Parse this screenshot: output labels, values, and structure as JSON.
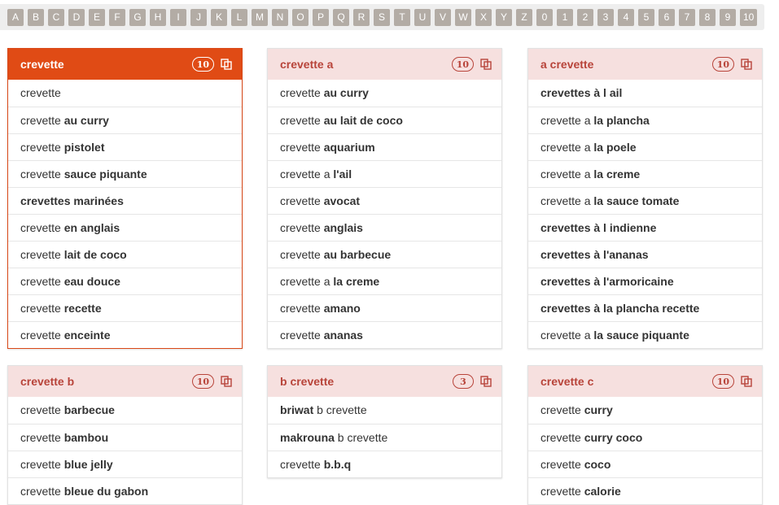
{
  "alphabet": [
    "A",
    "B",
    "C",
    "D",
    "E",
    "F",
    "G",
    "H",
    "I",
    "J",
    "K",
    "L",
    "M",
    "N",
    "O",
    "P",
    "Q",
    "R",
    "S",
    "T",
    "U",
    "V",
    "W",
    "X",
    "Y",
    "Z",
    "0",
    "1",
    "2",
    "3",
    "4",
    "5",
    "6",
    "7",
    "8",
    "9",
    "10"
  ],
  "colors": {
    "accent": "#e04b15",
    "header_pink": "#f6e0df",
    "title_red": "#b8443a",
    "letter_button": "#b3aca5",
    "bar_bg": "#eeeeee"
  },
  "icons": {
    "copy": "copy-icon"
  },
  "cards": [
    {
      "title": "crevette",
      "count": "10",
      "active": true,
      "rows": [
        {
          "pre": "crevette",
          "bold": "",
          "post": ""
        },
        {
          "pre": "crevette ",
          "bold": "au curry",
          "post": ""
        },
        {
          "pre": "crevette ",
          "bold": "pistolet",
          "post": ""
        },
        {
          "pre": "crevette ",
          "bold": "sauce piquante",
          "post": ""
        },
        {
          "pre": "",
          "bold": "crevettes marinées",
          "post": ""
        },
        {
          "pre": "crevette ",
          "bold": "en anglais",
          "post": ""
        },
        {
          "pre": "crevette ",
          "bold": "lait de coco",
          "post": ""
        },
        {
          "pre": "crevette ",
          "bold": "eau douce",
          "post": ""
        },
        {
          "pre": "crevette ",
          "bold": "recette",
          "post": ""
        },
        {
          "pre": "crevette ",
          "bold": "enceinte",
          "post": ""
        }
      ]
    },
    {
      "title": "crevette a",
      "count": "10",
      "active": false,
      "rows": [
        {
          "pre": "crevette ",
          "bold": "au curry",
          "post": ""
        },
        {
          "pre": "crevette ",
          "bold": "au lait de coco",
          "post": ""
        },
        {
          "pre": "crevette ",
          "bold": "aquarium",
          "post": ""
        },
        {
          "pre": "crevette a ",
          "bold": "l'ail",
          "post": ""
        },
        {
          "pre": "crevette ",
          "bold": "avocat",
          "post": ""
        },
        {
          "pre": "crevette ",
          "bold": "anglais",
          "post": ""
        },
        {
          "pre": "crevette ",
          "bold": "au barbecue",
          "post": ""
        },
        {
          "pre": "crevette a ",
          "bold": "la creme",
          "post": ""
        },
        {
          "pre": "crevette ",
          "bold": "amano",
          "post": ""
        },
        {
          "pre": "crevette ",
          "bold": "ananas",
          "post": ""
        }
      ]
    },
    {
      "title": "a crevette",
      "count": "10",
      "active": false,
      "rows": [
        {
          "pre": "",
          "bold": "crevettes à l ail",
          "post": ""
        },
        {
          "pre": "crevette a ",
          "bold": "la plancha",
          "post": ""
        },
        {
          "pre": "crevette a ",
          "bold": "la poele",
          "post": ""
        },
        {
          "pre": "crevette a ",
          "bold": "la creme",
          "post": ""
        },
        {
          "pre": "crevette a ",
          "bold": "la sauce tomate",
          "post": ""
        },
        {
          "pre": "",
          "bold": "crevettes à l indienne",
          "post": ""
        },
        {
          "pre": "",
          "bold": "crevettes à l'ananas",
          "post": ""
        },
        {
          "pre": "",
          "bold": "crevettes à l'armoricaine",
          "post": ""
        },
        {
          "pre": "",
          "bold": "crevettes à la plancha recette",
          "post": ""
        },
        {
          "pre": "crevette a ",
          "bold": "la sauce piquante",
          "post": ""
        }
      ]
    },
    {
      "title": "crevette b",
      "count": "10",
      "active": false,
      "rows": [
        {
          "pre": "crevette ",
          "bold": "barbecue",
          "post": ""
        },
        {
          "pre": "crevette ",
          "bold": "bambou",
          "post": ""
        },
        {
          "pre": "crevette ",
          "bold": "blue jelly",
          "post": ""
        },
        {
          "pre": "crevette ",
          "bold": "bleue du gabon",
          "post": ""
        }
      ]
    },
    {
      "title": "b crevette",
      "count": "3",
      "active": false,
      "rows": [
        {
          "pre": "",
          "bold": "briwat",
          "post": " b crevette"
        },
        {
          "pre": "",
          "bold": "makrouna",
          "post": " b crevette"
        },
        {
          "pre": "crevette ",
          "bold": "b.b.q",
          "post": ""
        }
      ]
    },
    {
      "title": "crevette c",
      "count": "10",
      "active": false,
      "rows": [
        {
          "pre": "crevette ",
          "bold": "curry",
          "post": ""
        },
        {
          "pre": "crevette ",
          "bold": "curry coco",
          "post": ""
        },
        {
          "pre": "crevette ",
          "bold": "coco",
          "post": ""
        },
        {
          "pre": "crevette ",
          "bold": "calorie",
          "post": ""
        }
      ]
    }
  ]
}
